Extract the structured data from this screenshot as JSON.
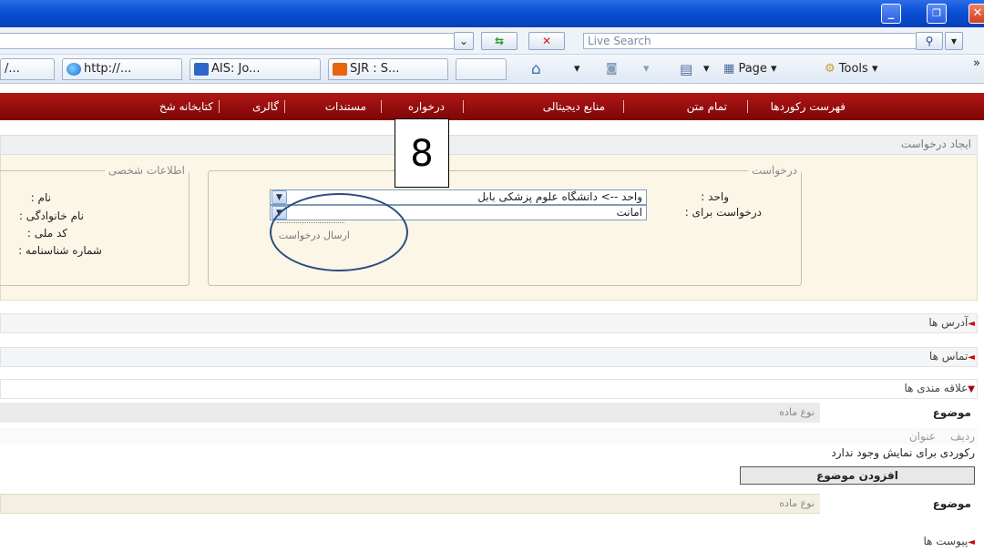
{
  "browser": {
    "window_buttons": {
      "minimize": "_",
      "restore": "❐",
      "close": "✕"
    },
    "search_placeholder": "Live Search",
    "tabs": [
      {
        "label": "/..."
      },
      {
        "label": "http://..."
      },
      {
        "label": "AIS: Jo..."
      },
      {
        "label": "SJR : S..."
      }
    ],
    "tools": {
      "page_label": "Page",
      "tools_label": "Tools"
    }
  },
  "nav": {
    "items": [
      "فهرست رکوردها",
      "تمام متن",
      "منابع دیجیتالی",
      "درخواره",
      "مستندات",
      "گالری",
      "کتابخانه شخ"
    ]
  },
  "create_request": {
    "title": "ایجاد درخواست",
    "step_number": "8",
    "request_fieldset": {
      "legend": "درخواست",
      "unit_label": "واحد :",
      "unit_value": "واحد --> دانشگاه علوم پزشکی بابل",
      "request_for_label": "درخواست برای :",
      "request_for_value": "امانت",
      "send_link": "ارسال درخواست"
    },
    "personal_fieldset": {
      "legend": "اطلاعات شخصی",
      "fields": [
        "نام :",
        "نام خانوادگی :",
        "کد ملی :",
        "شماره شناسنامه :"
      ]
    }
  },
  "sections": {
    "addresses": "آدرس ها",
    "contacts": "تماس ها",
    "interests": "علاقه مندی ها",
    "attachments": "پیوست ها"
  },
  "interests": {
    "subject_header": "موضوع",
    "material_type": "نوع ماده",
    "col_row": "ردیف",
    "col_title": "عنوان",
    "empty_message": "رکوردی برای نمایش وجود ندارد",
    "add_button": "افزودن موضوع"
  },
  "colors": {
    "nav_bg": "#9b0c0c",
    "panel_bg": "#fbf6e6",
    "annotation": "#2b4d7e"
  }
}
